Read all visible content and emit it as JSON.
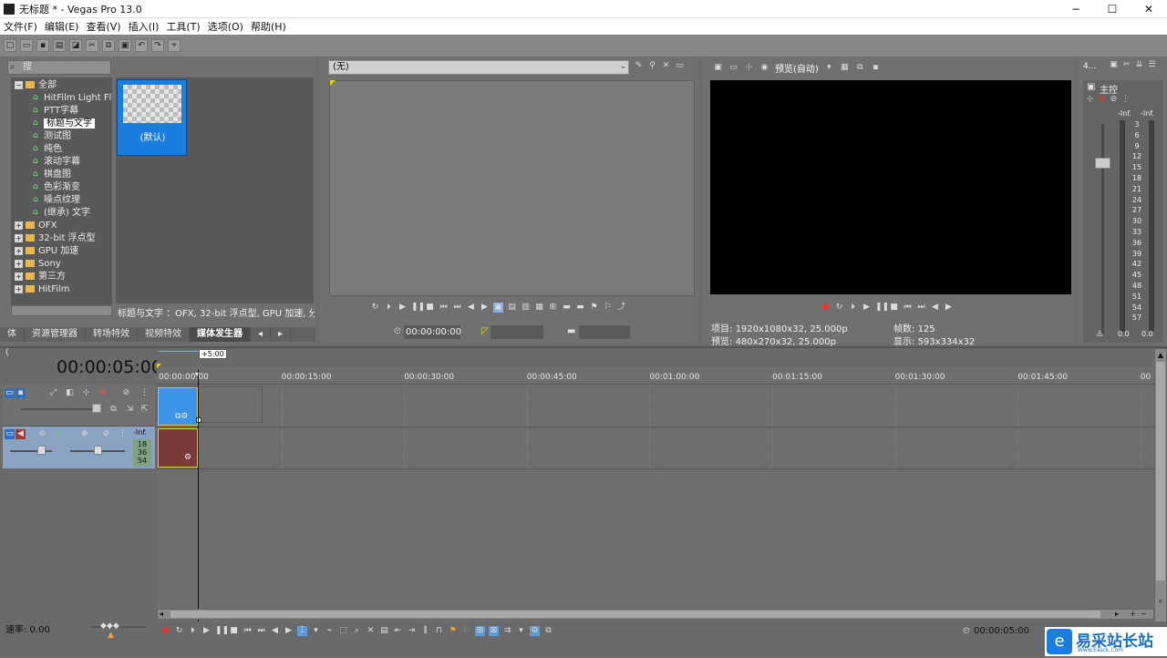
{
  "window": {
    "title": "无标题 * - Vegas Pro 13.0",
    "minimize": "−",
    "maximize": "☐",
    "close": "✕"
  },
  "menu": [
    "文件(F)",
    "编辑(E)",
    "查看(V)",
    "插入(I)",
    "工具(T)",
    "选项(O)",
    "帮助(H)"
  ],
  "explorer": {
    "search_placeholder": "搜",
    "tree": [
      {
        "label": "全部",
        "type": "root"
      },
      {
        "label": "HitFilm Light Flar",
        "type": "leaf"
      },
      {
        "label": "PTT字幕",
        "type": "leaf"
      },
      {
        "label": "标题与文字",
        "type": "leaf",
        "selected": true
      },
      {
        "label": "测试图",
        "type": "leaf"
      },
      {
        "label": "纯色",
        "type": "leaf"
      },
      {
        "label": "滚动字幕",
        "type": "leaf"
      },
      {
        "label": "棋盘图",
        "type": "leaf"
      },
      {
        "label": "色彩渐变",
        "type": "leaf"
      },
      {
        "label": "噪点纹理",
        "type": "leaf"
      },
      {
        "label": "(继承) 文字",
        "type": "leaf"
      },
      {
        "label": "OFX",
        "type": "folder"
      },
      {
        "label": "32-bit 浮点型",
        "type": "folder"
      },
      {
        "label": "GPU 加速",
        "type": "folder"
      },
      {
        "label": "Sony",
        "type": "folder"
      },
      {
        "label": "第三方",
        "type": "folder"
      },
      {
        "label": "HitFilm",
        "type": "folder"
      }
    ],
    "preset_label": "(默认)",
    "status": "标题与文字 ：OFX, 32-bit 浮点型, GPU 加速, 分",
    "tabs": [
      "体",
      "资源管理器",
      "转场特效",
      "视频特效",
      "媒体发生器"
    ],
    "active_tab": "媒体发生器"
  },
  "trimmer": {
    "dropdown": "(无)",
    "timecode": "00:00:00:00"
  },
  "preview": {
    "mode": "预览(自动)",
    "project_label": "项目:",
    "project_value": "1920x1080x32, 25.000p",
    "preview_label": "预览:",
    "preview_value": "480x270x32, 25.000p",
    "frame_label": "帧数:",
    "frame_value": "125",
    "display_label": "显示:",
    "display_value": "593x334x32"
  },
  "mixer": {
    "title": "主控",
    "tab": "4...",
    "left_level": "-Inf.",
    "right_level": "-Inf.",
    "scale": [
      "3",
      "6",
      "9",
      "12",
      "15",
      "18",
      "21",
      "24",
      "27",
      "30",
      "33",
      "36",
      "39",
      "42",
      "45",
      "48",
      "51",
      "54",
      "57"
    ],
    "bottom_left": "0.0",
    "bottom_right": "0.0"
  },
  "timeline": {
    "timecode": "00:00:05:00",
    "marker": "+5:00",
    "ruler": [
      "00:00:00:00",
      "00:00:15:00",
      "00:00:30:00",
      "00:00:45:00",
      "00:01:00:00",
      "00:01:15:00",
      "00:01:30:00",
      "00:01:45:00",
      "00"
    ],
    "audio_level": "-Inf.",
    "audio_meter": [
      "18",
      "36",
      "54"
    ],
    "rate": "速率: 0.00",
    "end_timecode": "00:00:05:00",
    "record_label": "录制"
  },
  "watermark": {
    "text": "易采站长站",
    "sub": "Www.Easck.Com"
  },
  "colors": {
    "accent": "#1a7de0",
    "video_clip": "#3b94e8",
    "audio_clip": "#7a3a3a"
  }
}
